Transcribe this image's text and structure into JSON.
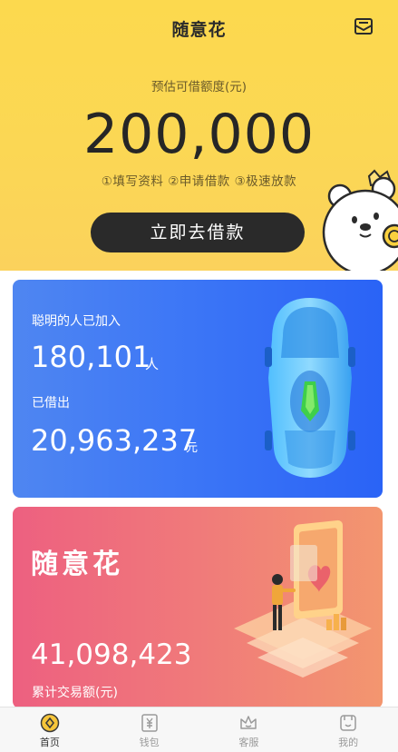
{
  "header": {
    "title": "随意花"
  },
  "hero": {
    "quota_label": "预估可借额度(元)",
    "quota_amount": "200,000",
    "steps": "①填写资料 ②申请借款 ③极速放款",
    "loan_button": "立即去借款"
  },
  "stats_card": {
    "joined_label": "聪明的人已加入",
    "joined_count": "180,101",
    "joined_unit": "人",
    "borrowed_label": "已借出",
    "borrowed_amount": "20,963,237",
    "borrowed_unit": "元"
  },
  "brand_card": {
    "title": "随意花",
    "volume": "41,098,423",
    "volume_label": "累计交易额(元)"
  },
  "tabbar": {
    "items": [
      {
        "label": "首页",
        "icon": "home-coin-icon",
        "active": true
      },
      {
        "label": "钱包",
        "icon": "wallet-yen-icon",
        "active": false
      },
      {
        "label": "客服",
        "icon": "crown-service-icon",
        "active": false
      },
      {
        "label": "我的",
        "icon": "profile-icon",
        "active": false
      }
    ]
  },
  "colors": {
    "hero_yellow": "#fcd94e",
    "button_dark": "#2a2a2a",
    "card_blue": "#3d77f6",
    "card_pink": "#ed6080",
    "tab_active": "#333333",
    "tab_inactive": "#9a9a9a"
  }
}
